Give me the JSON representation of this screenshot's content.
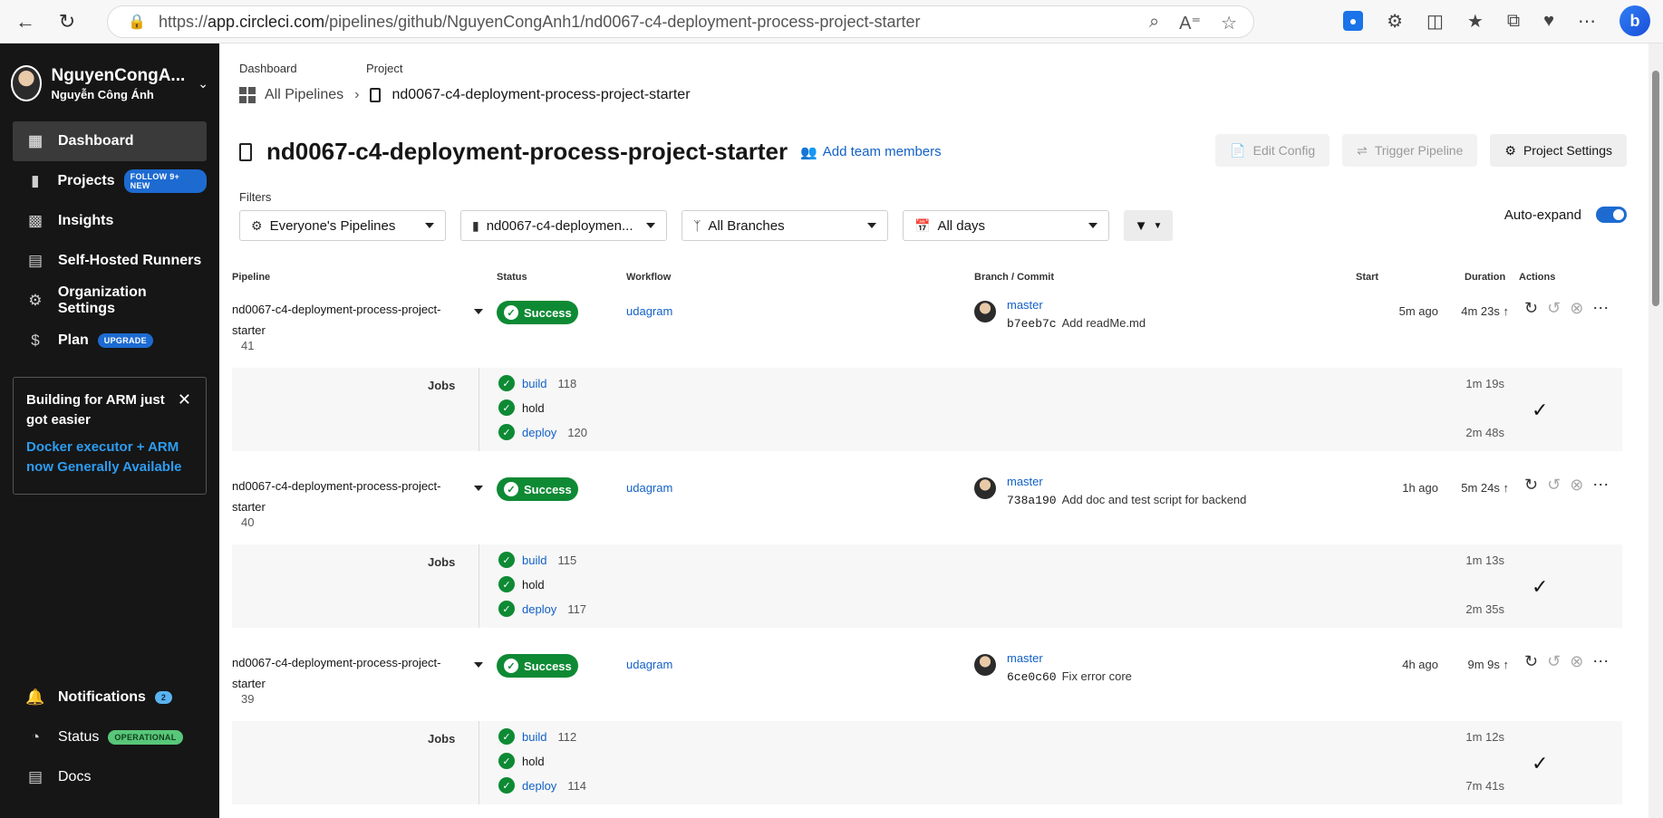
{
  "browser": {
    "url_prefix": "https://",
    "url_host": "app.circleci.com",
    "url_path": "/pipelines/github/NguyenCongAnh1/nd0067-c4-deployment-process-project-starter",
    "bing_label": "b"
  },
  "sidebar": {
    "username": "NguyenCongA...",
    "fullname": "Nguyễn Công Ánh",
    "items": [
      {
        "label": "Dashboard",
        "icon": "dashboard-icon"
      },
      {
        "label": "Projects",
        "icon": "projects-icon",
        "pill": "FOLLOW 9+ NEW"
      },
      {
        "label": "Insights",
        "icon": "insights-icon"
      },
      {
        "label": "Self-Hosted Runners",
        "icon": "runners-icon"
      },
      {
        "label": "Organization Settings",
        "icon": "gear-icon"
      },
      {
        "label": "Plan",
        "icon": "dollar-icon",
        "pill": "UPGRADE"
      }
    ],
    "promo": {
      "title": "Building for ARM just got easier",
      "link": "Docker executor + ARM now Generally Available"
    },
    "bottom": [
      {
        "label": "Notifications",
        "icon": "bell-icon",
        "count": "2"
      },
      {
        "label": "Status",
        "icon": "status-icon",
        "pill": "OPERATIONAL"
      },
      {
        "label": "Docs",
        "icon": "docs-icon"
      }
    ]
  },
  "breadcrumb": {
    "dashboard_label": "Dashboard",
    "project_label": "Project",
    "all_pipelines": "All Pipelines",
    "current": "nd0067-c4-deployment-process-project-starter"
  },
  "header": {
    "title": "nd0067-c4-deployment-process-project-starter",
    "add_team": "Add team members",
    "edit_config": "Edit Config",
    "trigger_pipeline": "Trigger Pipeline",
    "project_settings": "Project Settings"
  },
  "filters": {
    "label": "Filters",
    "pipelines": "Everyone's Pipelines",
    "project": "nd0067-c4-deploymen...",
    "branches": "All Branches",
    "days": "All days",
    "auto_expand": "Auto-expand"
  },
  "table": {
    "columns": [
      "Pipeline",
      "Status",
      "Workflow",
      "Branch / Commit",
      "Start",
      "Duration",
      "Actions"
    ],
    "jobs_label": "Jobs",
    "pipelines": [
      {
        "name": "nd0067-c4-deployment-process-project-starter",
        "number": "41",
        "status": "Success",
        "workflow": "udagram",
        "branch": "master",
        "sha": "b7eeb7c",
        "message": "Add readMe.md",
        "start": "5m ago",
        "duration": "4m 23s",
        "jobs": [
          {
            "name": "build",
            "num": "118"
          },
          {
            "name": "hold",
            "num": ""
          },
          {
            "name": "deploy",
            "num": "120"
          }
        ],
        "job_dur_top": "1m 19s",
        "job_dur_bottom": "2m 48s"
      },
      {
        "name": "nd0067-c4-deployment-process-project-starter",
        "number": "40",
        "status": "Success",
        "workflow": "udagram",
        "branch": "master",
        "sha": "738a190",
        "message": "Add doc and test script for backend",
        "start": "1h ago",
        "duration": "5m 24s",
        "jobs": [
          {
            "name": "build",
            "num": "115"
          },
          {
            "name": "hold",
            "num": ""
          },
          {
            "name": "deploy",
            "num": "117"
          }
        ],
        "job_dur_top": "1m 13s",
        "job_dur_bottom": "2m 35s"
      },
      {
        "name": "nd0067-c4-deployment-process-project-starter",
        "number": "39",
        "status": "Success",
        "workflow": "udagram",
        "branch": "master",
        "sha": "6ce0c60",
        "message": "Fix error core",
        "start": "4h ago",
        "duration": "9m 9s",
        "jobs": [
          {
            "name": "build",
            "num": "112"
          },
          {
            "name": "hold",
            "num": ""
          },
          {
            "name": "deploy",
            "num": "114"
          }
        ],
        "job_dur_top": "1m 12s",
        "job_dur_bottom": "7m 41s"
      }
    ]
  }
}
